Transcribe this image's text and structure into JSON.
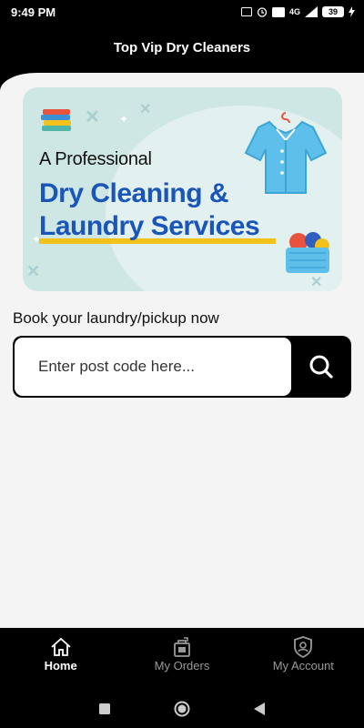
{
  "status_bar": {
    "time": "9:49 PM",
    "network": "4G",
    "battery": "39"
  },
  "header": {
    "title": "Top Vip Dry Cleaners"
  },
  "banner": {
    "subtitle": "A Professional",
    "line1": "Dry Cleaning &",
    "line2": "Laundry Services",
    "accent_color": "#1a55b8",
    "underline_color": "#f2c21b"
  },
  "booking": {
    "label": "Book your laundry/pickup now",
    "postcode_placeholder": "Enter post code here...",
    "postcode_value": ""
  },
  "bottom_nav": {
    "items": [
      {
        "label": "Home",
        "icon": "home-icon",
        "active": true
      },
      {
        "label": "My Orders",
        "icon": "orders-icon",
        "active": false
      },
      {
        "label": "My Account",
        "icon": "account-icon",
        "active": false
      }
    ]
  },
  "system_nav": {
    "icons": [
      "square-recents-icon",
      "circle-home-icon",
      "triangle-back-icon"
    ]
  }
}
